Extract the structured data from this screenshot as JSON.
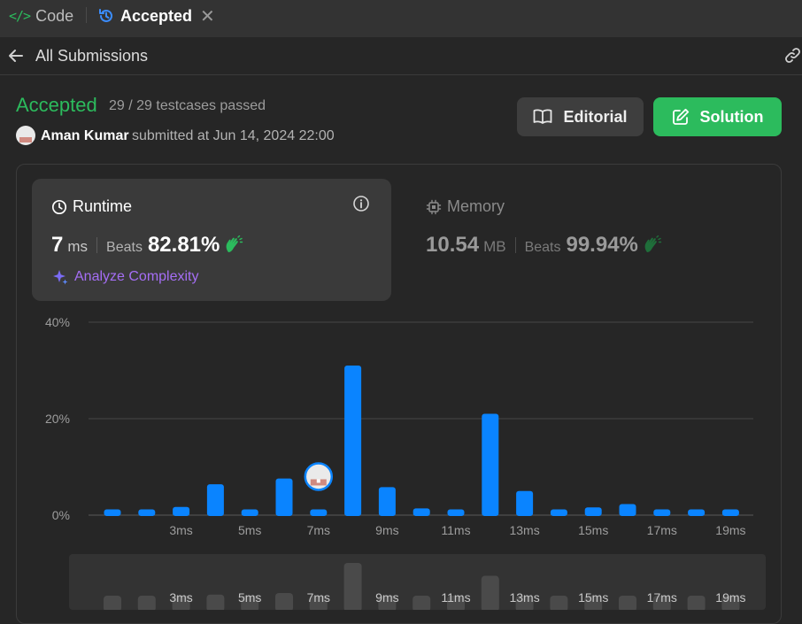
{
  "tabs": {
    "code_label": "Code",
    "accepted_label": "Accepted"
  },
  "subbar": {
    "back_label": "All Submissions"
  },
  "submission": {
    "status": "Accepted",
    "testcases": "29 / 29 testcases passed",
    "author": "Aman Kumar",
    "submitted": "submitted at Jun 14, 2024 22:00"
  },
  "buttons": {
    "editorial": "Editorial",
    "solution": "Solution"
  },
  "runtime": {
    "title": "Runtime",
    "value": "7",
    "unit": "ms",
    "beats_label": "Beats",
    "beats_pct": "82.81%",
    "analyze": "Analyze Complexity"
  },
  "memory": {
    "title": "Memory",
    "value": "10.54",
    "unit": "MB",
    "beats_label": "Beats",
    "beats_pct": "99.94%"
  },
  "colors": {
    "accent_green": "#2cbb5d",
    "bar_blue": "#0a84ff",
    "analyze_purple": "#a56ef5"
  },
  "chart_data": {
    "type": "bar",
    "title": "",
    "xlabel": "",
    "ylabel": "",
    "ylim": [
      0,
      40
    ],
    "yticks": [
      "0%",
      "20%",
      "40%"
    ],
    "ytick_values": [
      0,
      20,
      40
    ],
    "grid": true,
    "categories": [
      1,
      2,
      3,
      4,
      5,
      6,
      7,
      8,
      9,
      10,
      11,
      12,
      13,
      14,
      15,
      16,
      17,
      18,
      19
    ],
    "xtick_labels": {
      "3": "3ms",
      "5": "5ms",
      "7": "7ms",
      "9": "9ms",
      "11": "11ms",
      "13": "13ms",
      "15": "15ms",
      "17": "17ms",
      "19": "19ms"
    },
    "values": [
      1.2,
      1.2,
      1.7,
      6.4,
      1.2,
      7.6,
      1.2,
      31.0,
      5.8,
      1.4,
      1.2,
      21.0,
      5.0,
      1.2,
      1.6,
      2.3,
      1.2,
      1.2,
      1.2
    ],
    "highlight_category": 7,
    "slider_xtick_labels": {
      "3": "3ms",
      "5": "5ms",
      "7": "7ms",
      "9": "9ms",
      "11": "11ms",
      "13": "13ms",
      "15": "15ms",
      "17": "17ms",
      "19": "19ms"
    }
  }
}
